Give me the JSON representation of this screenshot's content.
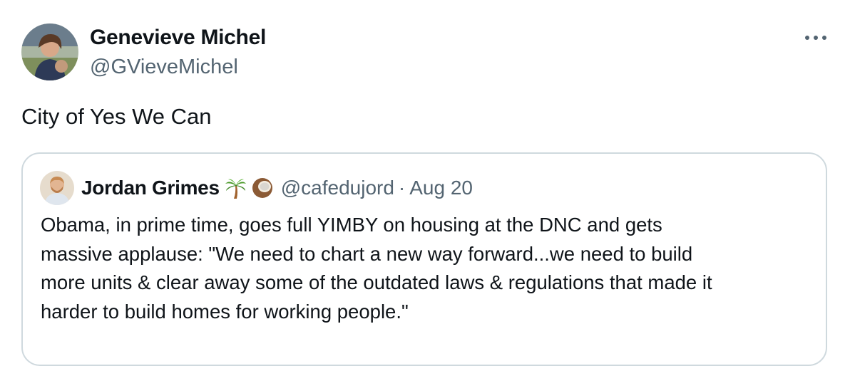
{
  "tweet": {
    "author_name": "Genevieve Michel",
    "author_handle": "@GVieveMichel",
    "text": "City of Yes We Can",
    "avatar_icon": "user-photo-avatar",
    "more_icon": "more-options-icon"
  },
  "quote": {
    "author_name": "Jordan Grimes",
    "emojis": [
      "palm-tree-icon",
      "coconut-icon"
    ],
    "author_handle": "@cafedujord",
    "separator": "·",
    "date": "Aug 20",
    "text_lines": [
      "Obama, in prime time, goes full YIMBY on housing at the DNC and gets",
      "massive applause: \"We need to chart a new way forward...we need to build",
      "more units & clear away some of the outdated laws & regulations that made it",
      "harder to build homes for working people.\""
    ]
  },
  "colors": {
    "text_primary": "#0f1419",
    "text_secondary": "#536471",
    "border": "#cfd9de"
  }
}
